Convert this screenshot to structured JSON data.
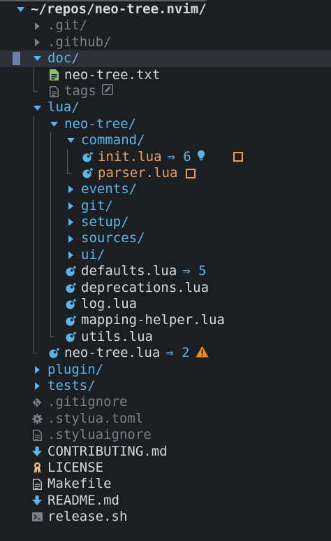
{
  "colors": {
    "background": "#1c1e22",
    "selected_row": "#2e3138",
    "selection_marker": "#6e7faa",
    "root_text": "#d5d8de",
    "directory": "#58b6eb",
    "hidden": "#7b7f88",
    "file": "#d5d8de",
    "modified": "#e6a15d",
    "lsp_ref": "#58b6eb",
    "hint": "#58b6eb",
    "warning": "#ef8f15",
    "guide": "#545862",
    "arrow_dim": "#7b7f88",
    "txt_icon": "#8cc265",
    "lua_icon": "#58b6eb",
    "markdown_icon": "#58b6eb",
    "license_icon": "#e5c07b",
    "makefile_icon": "#b8bcc5",
    "shell_icon": "#7b7f88",
    "gear_icon": "#7b7f88",
    "git_icon": "#7b7f88"
  },
  "tree": {
    "root_label": "~/repos/neo-tree.nvim/",
    "rows": [
      {
        "id": "root",
        "depth": 0,
        "kind": "root-dir",
        "name": "~/repos/neo-tree.nvim/",
        "open": true
      },
      {
        "id": "git",
        "depth": 1,
        "kind": "dir",
        "name": ".git/",
        "open": false,
        "hidden": true
      },
      {
        "id": "github",
        "depth": 1,
        "kind": "dir",
        "name": ".github/",
        "open": false,
        "hidden": true
      },
      {
        "id": "doc",
        "depth": 1,
        "kind": "dir",
        "name": "doc/",
        "open": true,
        "selected": true
      },
      {
        "id": "neo-tree-txt",
        "depth": 2,
        "kind": "file",
        "icon": "text-file-icon",
        "name": "neo-tree.txt"
      },
      {
        "id": "tags",
        "depth": 2,
        "kind": "file",
        "icon": "doc-file-icon",
        "name": "tags",
        "hidden": true,
        "last": true,
        "suffix_icon": "edit-icon"
      },
      {
        "id": "lua",
        "depth": 1,
        "kind": "dir",
        "name": "lua/",
        "open": true
      },
      {
        "id": "neo-tree-dir",
        "depth": 2,
        "kind": "dir",
        "name": "neo-tree/",
        "open": true
      },
      {
        "id": "command",
        "depth": 3,
        "kind": "dir",
        "name": "command/",
        "open": true
      },
      {
        "id": "init-lua",
        "depth": 4,
        "kind": "file",
        "icon": "lua-icon",
        "name": "init.lua",
        "modified": true,
        "refs": "⇒ 6",
        "hint_icon": "lightbulb-icon",
        "status_icon": "modified-square-icon"
      },
      {
        "id": "parser-lua",
        "depth": 4,
        "kind": "file",
        "icon": "lua-icon",
        "name": "parser.lua",
        "modified": true,
        "last": true,
        "status_icon": "modified-square-icon"
      },
      {
        "id": "events",
        "depth": 3,
        "kind": "dir",
        "name": "events/",
        "open": false
      },
      {
        "id": "git-dir",
        "depth": 3,
        "kind": "dir",
        "name": "git/",
        "open": false
      },
      {
        "id": "setup",
        "depth": 3,
        "kind": "dir",
        "name": "setup/",
        "open": false
      },
      {
        "id": "sources",
        "depth": 3,
        "kind": "dir",
        "name": "sources/",
        "open": false
      },
      {
        "id": "ui",
        "depth": 3,
        "kind": "dir",
        "name": "ui/",
        "open": false
      },
      {
        "id": "defaults-lua",
        "depth": 3,
        "kind": "file",
        "icon": "lua-icon",
        "name": "defaults.lua",
        "refs": "⇒ 5"
      },
      {
        "id": "deprecations-lua",
        "depth": 3,
        "kind": "file",
        "icon": "lua-icon",
        "name": "deprecations.lua"
      },
      {
        "id": "log-lua",
        "depth": 3,
        "kind": "file",
        "icon": "lua-icon",
        "name": "log.lua"
      },
      {
        "id": "mapping-helper-lua",
        "depth": 3,
        "kind": "file",
        "icon": "lua-icon",
        "name": "mapping-helper.lua"
      },
      {
        "id": "utils-lua",
        "depth": 3,
        "kind": "file",
        "icon": "lua-icon",
        "name": "utils.lua",
        "last": true
      },
      {
        "id": "neo-tree-lua",
        "depth": 2,
        "kind": "file",
        "icon": "lua-icon",
        "name": "neo-tree.lua",
        "last": true,
        "refs": "⇒ 2",
        "warn_icon": "warning-icon"
      },
      {
        "id": "plugin",
        "depth": 1,
        "kind": "dir",
        "name": "plugin/",
        "open": false
      },
      {
        "id": "tests",
        "depth": 1,
        "kind": "dir",
        "name": "tests/",
        "open": false
      },
      {
        "id": "gitignore",
        "depth": 1,
        "kind": "file",
        "icon": "git-icon",
        "name": ".gitignore",
        "hidden": true
      },
      {
        "id": "stylua-toml",
        "depth": 1,
        "kind": "file",
        "icon": "gear-icon",
        "name": ".stylua.toml",
        "hidden": true
      },
      {
        "id": "styluaignore",
        "depth": 1,
        "kind": "file",
        "icon": "doc-file-icon",
        "name": ".styluaignore",
        "hidden": true
      },
      {
        "id": "contributing",
        "depth": 1,
        "kind": "file",
        "icon": "markdown-icon",
        "name": "CONTRIBUTING.md"
      },
      {
        "id": "license",
        "depth": 1,
        "kind": "file",
        "icon": "license-icon",
        "name": "LICENSE"
      },
      {
        "id": "makefile",
        "depth": 1,
        "kind": "file",
        "icon": "makefile-icon",
        "name": "Makefile"
      },
      {
        "id": "readme",
        "depth": 1,
        "kind": "file",
        "icon": "markdown-icon",
        "name": "README.md"
      },
      {
        "id": "release-sh",
        "depth": 1,
        "kind": "file",
        "icon": "terminal-icon",
        "name": "release.sh",
        "last": true
      }
    ]
  }
}
